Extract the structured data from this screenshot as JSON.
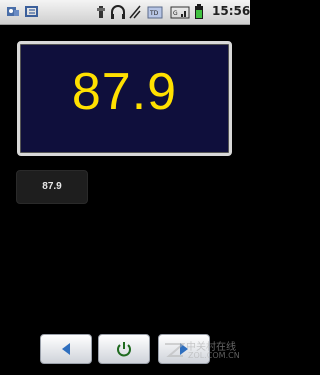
{
  "status_bar": {
    "time": "15:56",
    "left_icons": [
      "puzzle-icon",
      "message-icon"
    ],
    "right_icons": [
      "usb-icon",
      "headphones-icon",
      "signal-icon",
      "network-3g-icon",
      "battery-icon"
    ]
  },
  "radio": {
    "frequency": "87.9",
    "presets": [
      {
        "label": "87.9"
      }
    ]
  },
  "controls": {
    "prev": "previous-icon",
    "power": "power-icon",
    "next": "next-icon"
  },
  "watermark": {
    "text": "中关村在线",
    "sub": "ZOL.COM.CN"
  }
}
